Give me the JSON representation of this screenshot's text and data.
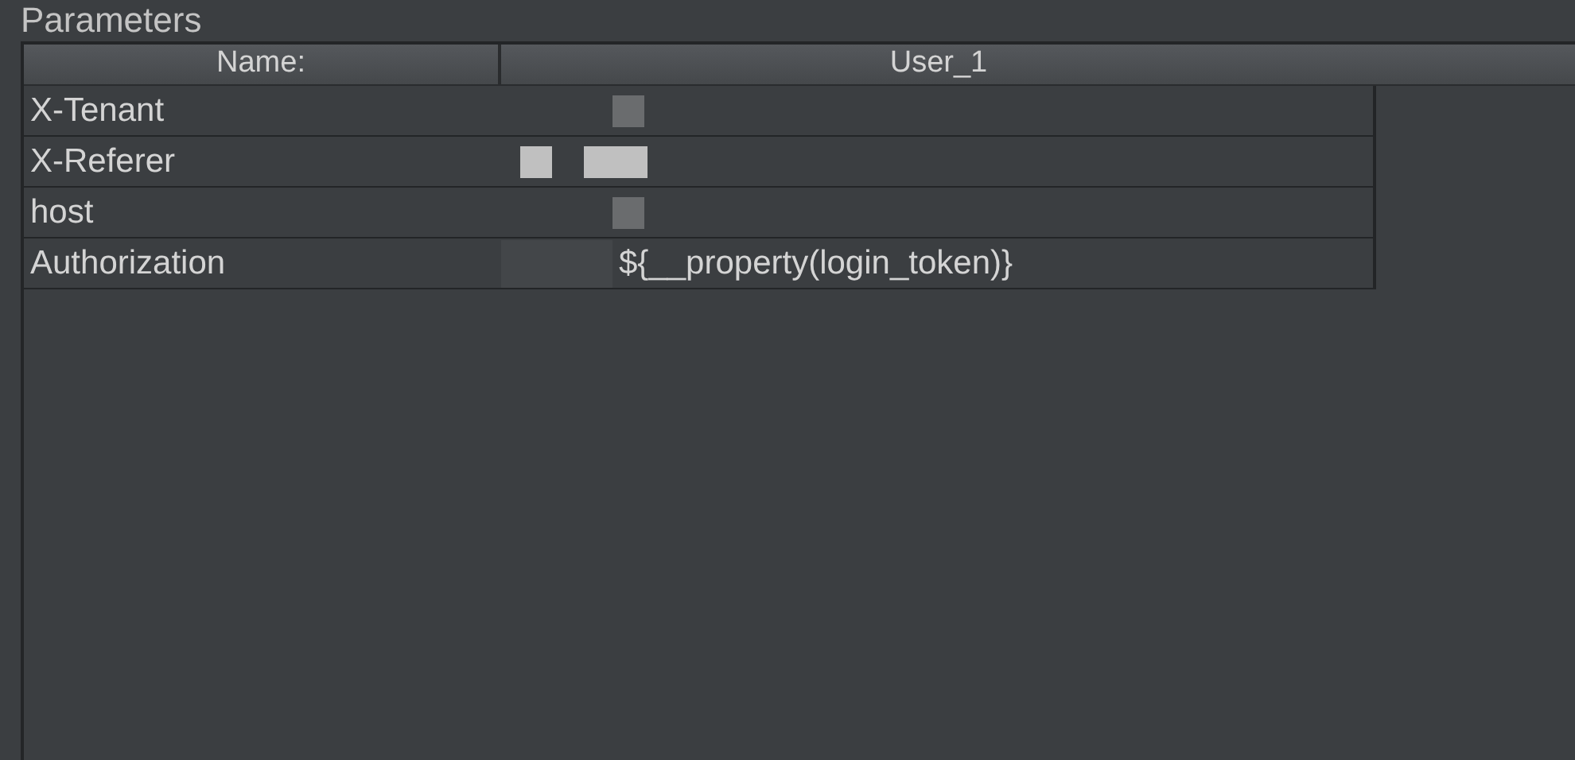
{
  "panel": {
    "title": "Parameters"
  },
  "table": {
    "columns": [
      "Name:",
      "User_1"
    ],
    "rows": [
      {
        "name": "X-Tenant",
        "redacted": true
      },
      {
        "name": "X-Referer",
        "redacted": true
      },
      {
        "name": "host",
        "redacted": true
      },
      {
        "name": "Authorization",
        "value": "${__property(login_token)}",
        "redacted": true
      }
    ]
  }
}
